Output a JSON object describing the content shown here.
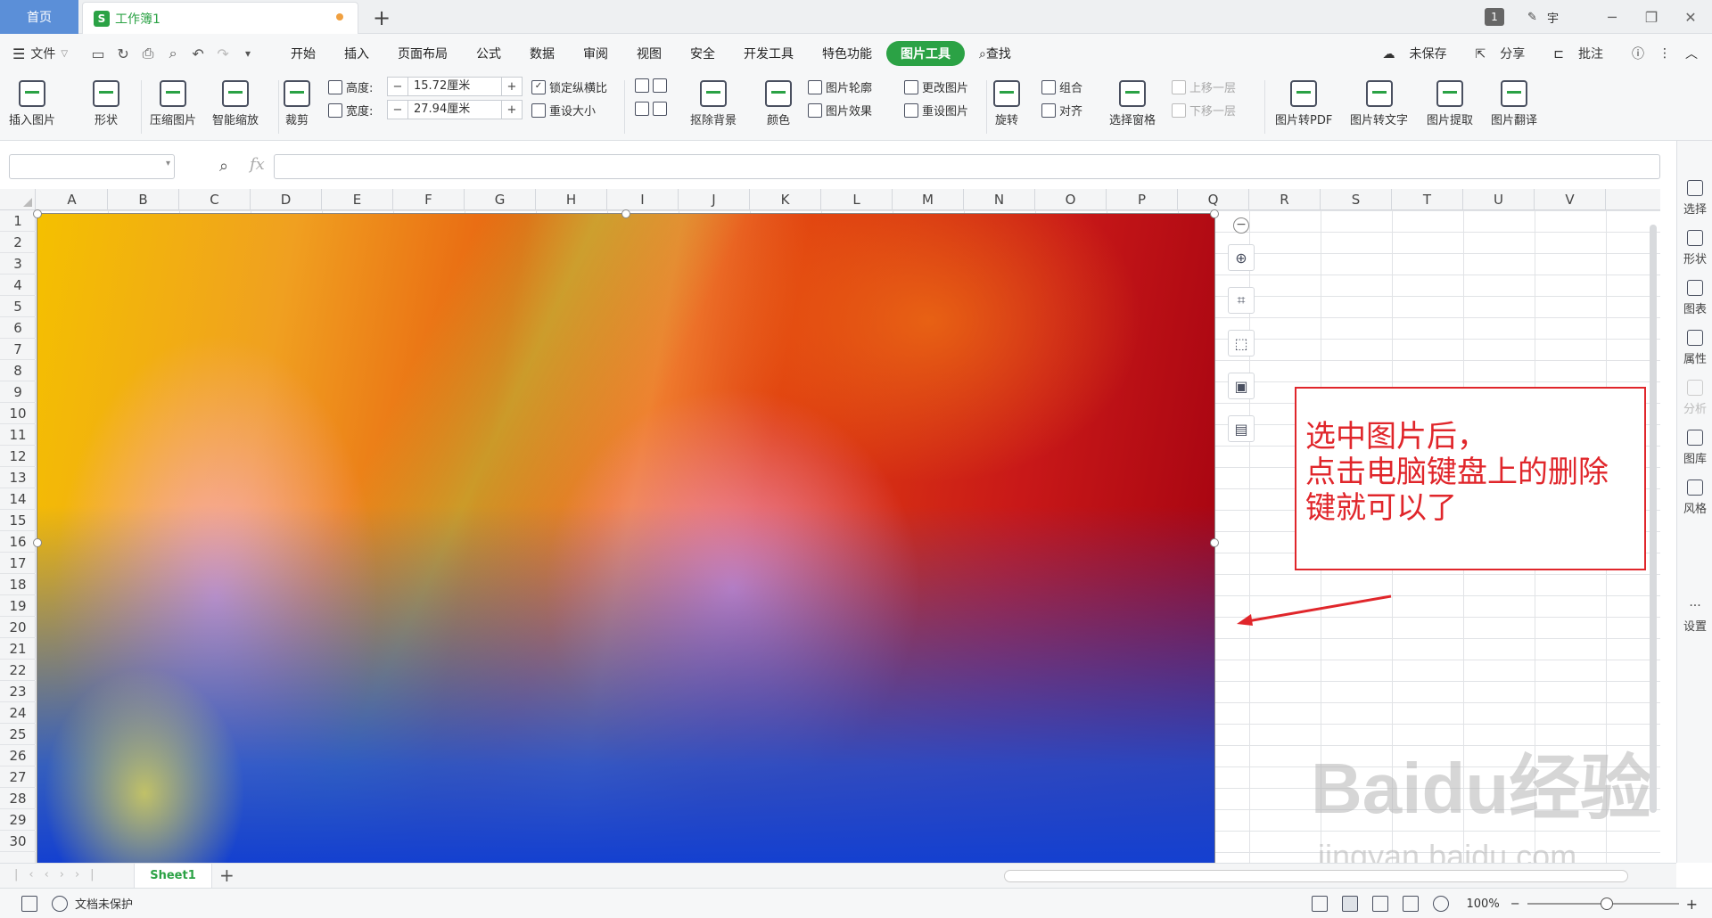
{
  "titlebar": {
    "home_tab": "首页",
    "doc_tab": "工作簿1",
    "app_logo": "S",
    "window_count": "1",
    "user": "宇"
  },
  "menubar": {
    "file": "文件",
    "tabs": [
      "开始",
      "插入",
      "页面布局",
      "公式",
      "数据",
      "审阅",
      "视图",
      "安全",
      "开发工具",
      "特色功能",
      "图片工具"
    ],
    "active_tab": "图片工具",
    "search": "查找",
    "unsaved": "未保存",
    "share": "分享",
    "comment": "批注"
  },
  "ribbon": {
    "insert_picture": "插入图片",
    "shape": "形状",
    "compress": "压缩图片",
    "smart_scale": "智能缩放",
    "crop": "裁剪",
    "height_label": "高度:",
    "height_value": "15.72厘米",
    "width_label": "宽度:",
    "width_value": "27.94厘米",
    "lock_ratio": "锁定纵横比",
    "reset_size": "重设大小",
    "remove_bg": "抠除背景",
    "color": "颜色",
    "outline": "图片轮廓",
    "effects": "图片效果",
    "change_picture": "更改图片",
    "reset_picture": "重设图片",
    "rotate": "旋转",
    "group": "组合",
    "align": "对齐",
    "selection_pane": "选择窗格",
    "bring_forward": "上移一层",
    "send_backward": "下移一层",
    "to_pdf": "图片转PDF",
    "to_text": "图片转文字",
    "extract": "图片提取",
    "translate": "图片翻译"
  },
  "formula": {
    "fx": "fx"
  },
  "grid": {
    "columns": [
      "A",
      "B",
      "C",
      "D",
      "E",
      "F",
      "G",
      "H",
      "I",
      "J",
      "K",
      "L",
      "M",
      "N",
      "O",
      "P",
      "Q",
      "R",
      "S",
      "T",
      "U",
      "V"
    ],
    "rows": [
      "1",
      "2",
      "3",
      "4",
      "5",
      "6",
      "7",
      "8",
      "9",
      "10",
      "11",
      "12",
      "13",
      "14",
      "15",
      "16",
      "17",
      "18",
      "19",
      "20",
      "21",
      "22",
      "23",
      "24",
      "25",
      "26",
      "27",
      "28",
      "29",
      "30"
    ]
  },
  "annotation": {
    "lines": [
      "选中图片后，",
      "点击电脑键盘上的删除",
      "键就可以了"
    ],
    "color": "#e0262b"
  },
  "sidepanel": [
    "选择",
    "形状",
    "图表",
    "属性",
    "分析",
    "图库",
    "风格",
    "设置"
  ],
  "sheet": {
    "name": "Sheet1"
  },
  "status": {
    "protect": "文档未保护",
    "zoom": "100%"
  },
  "watermark": {
    "brand": "Baidu经验",
    "url": "jingyan.baidu.com"
  },
  "colors": {
    "accent": "#2ba245",
    "home_tab": "#5b8fd8"
  }
}
